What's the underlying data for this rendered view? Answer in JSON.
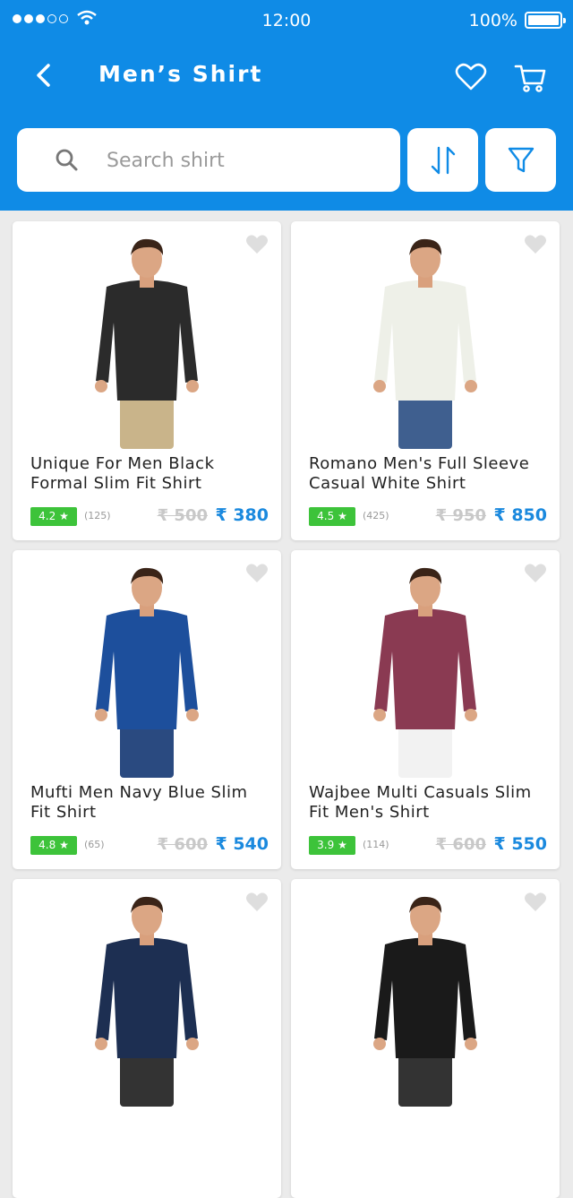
{
  "status_bar": {
    "time": "12:00",
    "battery": "100%"
  },
  "header": {
    "title": "Men’s Shirt"
  },
  "search": {
    "placeholder": "Search shirt"
  },
  "colors": {
    "accent": "#0f8be6",
    "price": "#1a89de",
    "rating_badge": "#3dc33a"
  },
  "products": [
    {
      "name": "Unique For Men Black Formal Slim Fit Shirt",
      "rating": "4.2 ★",
      "reviews": "(125)",
      "old_price": "₹ 500",
      "price": "₹ 380",
      "shirt_color": "#2b2b2b"
    },
    {
      "name": "Romano Men's Full Sleeve Casual White Shirt",
      "rating": "4.5 ★",
      "reviews": "(425)",
      "old_price": "₹ 950",
      "price": "₹ 850",
      "shirt_color": "#eef0e8"
    },
    {
      "name": "Mufti Men Navy Blue Slim Fit Shirt",
      "rating": "4.8 ★",
      "reviews": "(65)",
      "old_price": "₹ 600",
      "price": "₹ 540",
      "shirt_color": "#1d4f9c"
    },
    {
      "name": "Wajbee Multi Casuals Slim Fit Men's Shirt",
      "rating": "3.9 ★",
      "reviews": "(114)",
      "old_price": "₹ 600",
      "price": "₹ 550",
      "shirt_color": "#8a3a52"
    },
    {
      "shirt_color": "#1d2f52"
    },
    {
      "shirt_color": "#1a1a1a"
    }
  ]
}
